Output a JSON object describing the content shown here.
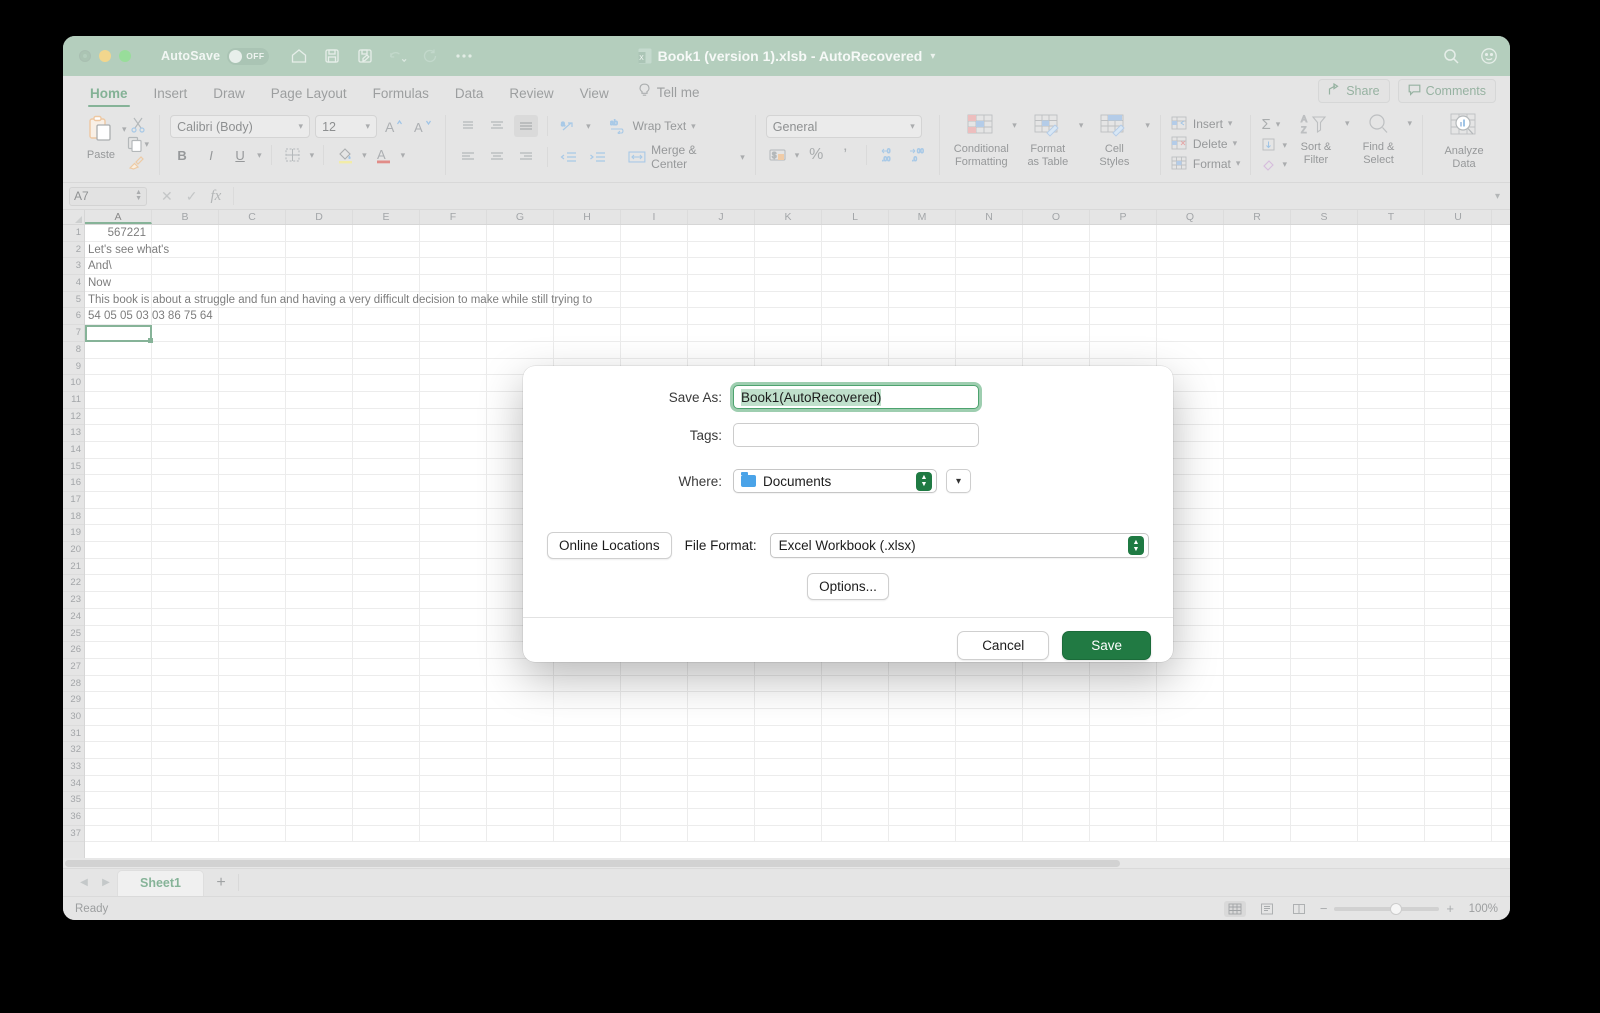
{
  "window": {
    "title": "Book1 (version 1).xlsb  -  AutoRecovered",
    "autosave_label": "AutoSave",
    "autosave_state": "OFF"
  },
  "quick_access": [
    {
      "name": "home-icon",
      "label": "Home"
    },
    {
      "name": "save-icon",
      "label": "Save"
    },
    {
      "name": "save-as-icon",
      "label": "Save As"
    },
    {
      "name": "undo-icon",
      "label": "Undo"
    },
    {
      "name": "redo-icon",
      "label": "Redo"
    },
    {
      "name": "more-icon",
      "label": "More"
    }
  ],
  "tabs": [
    {
      "label": "Home",
      "active": true
    },
    {
      "label": "Insert",
      "active": false
    },
    {
      "label": "Draw",
      "active": false
    },
    {
      "label": "Page Layout",
      "active": false
    },
    {
      "label": "Formulas",
      "active": false
    },
    {
      "label": "Data",
      "active": false
    },
    {
      "label": "Review",
      "active": false
    },
    {
      "label": "View",
      "active": false
    }
  ],
  "tellme": "Tell me",
  "share_label": "Share",
  "comments_label": "Comments",
  "ribbon": {
    "paste_label": "Paste",
    "font_name": "Calibri (Body)",
    "font_size": "12",
    "bold": "B",
    "italic": "I",
    "underline": "U",
    "wrap_text": "Wrap Text",
    "merge_center": "Merge & Center",
    "number_format": "General",
    "percent": "%",
    "comma": "’",
    "conditional_formatting": "Conditional\nFormatting",
    "conditional_formatting_l1": "Conditional",
    "conditional_formatting_l2": "Formatting",
    "format_as_table_l1": "Format",
    "format_as_table_l2": "as Table",
    "cell_styles_l1": "Cell",
    "cell_styles_l2": "Styles",
    "insert": "Insert",
    "delete": "Delete",
    "format": "Format",
    "sort_filter_l1": "Sort &",
    "sort_filter_l2": "Filter",
    "find_select_l1": "Find &",
    "find_select_l2": "Select",
    "analyze_data_l1": "Analyze",
    "analyze_data_l2": "Data"
  },
  "formula_bar": {
    "name_box": "A7",
    "formula": "",
    "fx": "fx"
  },
  "grid": {
    "columns": [
      "A",
      "B",
      "C",
      "D",
      "E",
      "F",
      "G",
      "H",
      "I",
      "J",
      "K",
      "L",
      "M",
      "N",
      "O",
      "P",
      "Q",
      "R",
      "S",
      "T",
      "U"
    ],
    "rows": [
      1,
      2,
      3,
      4,
      5,
      6,
      7,
      8,
      9,
      10,
      11,
      12,
      13,
      14,
      15,
      16,
      17,
      18,
      19,
      20,
      21,
      22,
      23,
      24,
      25,
      26,
      27,
      28,
      29,
      30,
      31,
      32,
      33,
      34,
      35,
      36,
      37
    ],
    "cells": [
      {
        "row": 1,
        "col": "A",
        "value": "567221",
        "align": "right"
      },
      {
        "row": 2,
        "col": "A",
        "value": "Let's see what's",
        "align": "left"
      },
      {
        "row": 3,
        "col": "A",
        "value": "And\\",
        "align": "left"
      },
      {
        "row": 4,
        "col": "A",
        "value": "Now",
        "align": "left"
      },
      {
        "row": 5,
        "col": "A",
        "value": "This book is about a struggle and fun and having a very difficult decision to make while still trying to",
        "align": "left"
      },
      {
        "row": 6,
        "col": "A",
        "value": "54 05 05 03 03 86 75 64",
        "align": "left"
      }
    ],
    "selected_cell": "A7",
    "selected_column": "A"
  },
  "sheet_tabs": {
    "sheets": [
      "Sheet1"
    ],
    "active": "Sheet1",
    "add_label": "+"
  },
  "status_bar": {
    "status": "Ready",
    "zoom": "100%",
    "views": [
      "normal-view",
      "page-layout-view",
      "page-break-view"
    ]
  },
  "dialog": {
    "save_as_label": "Save As:",
    "save_as_value": "Book1(AutoRecovered)",
    "tags_label": "Tags:",
    "tags_value": "",
    "where_label": "Where:",
    "where_value": "Documents",
    "online_locations": "Online Locations",
    "file_format_label": "File Format:",
    "file_format_value": "Excel Workbook (.xlsx)",
    "options": "Options...",
    "cancel": "Cancel",
    "save": "Save"
  },
  "colors": {
    "title_bar": "#7fab8e",
    "accent_green": "#2f7d4e",
    "save_button": "#217a43",
    "ribbon_bg": "#d2d2d2",
    "selection_highlight": "#bfe0cb"
  }
}
